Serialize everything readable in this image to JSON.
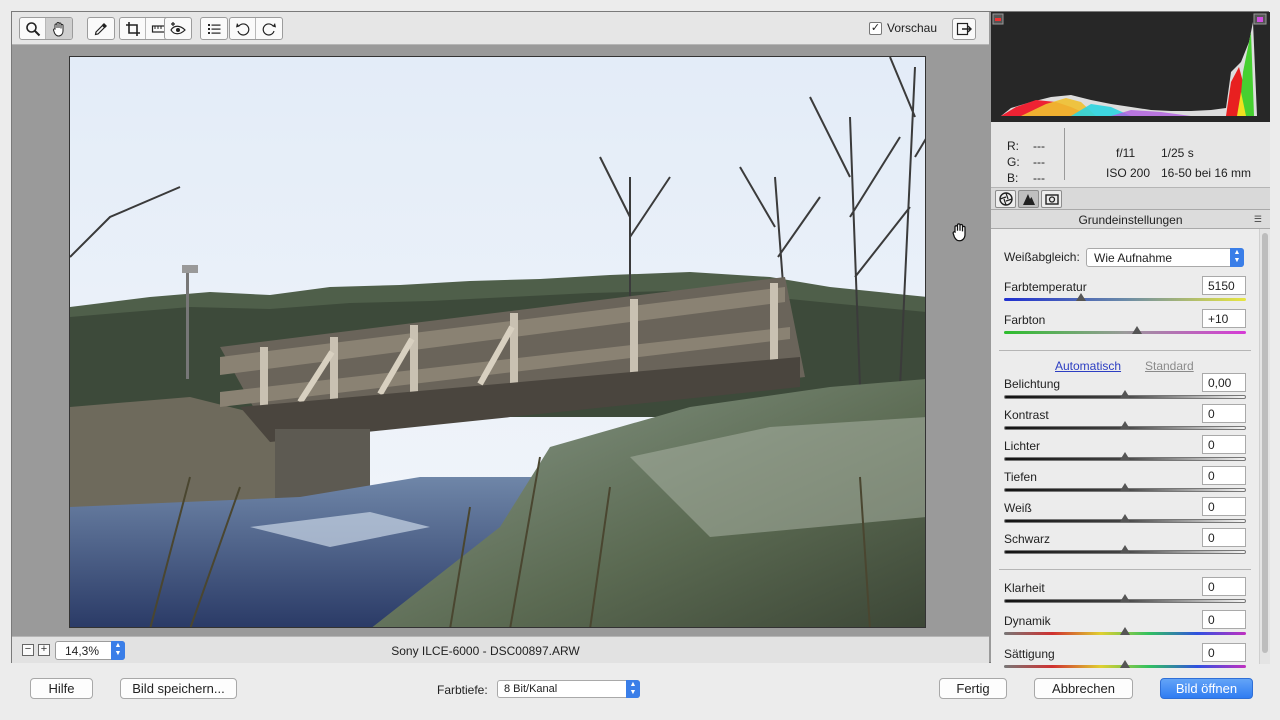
{
  "toolbar": {
    "tools": [
      "zoom-tool",
      "hand-tool",
      "white-balance-tool",
      "crop-tool",
      "straighten-tool",
      "spot-removal-tool",
      "presets-list",
      "rotate-left",
      "rotate-right"
    ],
    "preview_label": "Vorschau",
    "preview_checked": true
  },
  "statusbar": {
    "zoom": "14,3%",
    "filename": "Sony ILCE-6000 - DSC00897.ARW"
  },
  "histogram": {
    "r_label": "R:",
    "g_label": "G:",
    "b_label": "B:",
    "r_value": "---",
    "g_value": "---",
    "b_value": "---",
    "aperture": "f/11",
    "shutter": "1/25 s",
    "iso": "ISO 200",
    "lens": "16-50 bei 16 mm"
  },
  "panel": {
    "title": "Grundeinstellungen",
    "white_balance_label": "Weißabgleich:",
    "white_balance_value": "Wie Aufnahme",
    "auto_link": "Automatisch",
    "standard_link": "Standard",
    "sliders": {
      "temperature": {
        "label": "Farbtemperatur",
        "value": "5150"
      },
      "tint": {
        "label": "Farbton",
        "value": "+10"
      },
      "exposure": {
        "label": "Belichtung",
        "value": "0,00"
      },
      "contrast": {
        "label": "Kontrast",
        "value": "0"
      },
      "highlights": {
        "label": "Lichter",
        "value": "0"
      },
      "shadows": {
        "label": "Tiefen",
        "value": "0"
      },
      "whites": {
        "label": "Weiß",
        "value": "0"
      },
      "blacks": {
        "label": "Schwarz",
        "value": "0"
      },
      "clarity": {
        "label": "Klarheit",
        "value": "0"
      },
      "vibrance": {
        "label": "Dynamik",
        "value": "0"
      },
      "saturation": {
        "label": "Sättigung",
        "value": "0"
      }
    }
  },
  "footer": {
    "help": "Hilfe",
    "save_image": "Bild speichern...",
    "depth_label": "Farbtiefe:",
    "depth_value": "8 Bit/Kanal",
    "done": "Fertig",
    "cancel": "Abbrechen",
    "open_image": "Bild öffnen"
  },
  "colors": {
    "accent": "#2f7cf2",
    "link": "#2c3ec2"
  }
}
